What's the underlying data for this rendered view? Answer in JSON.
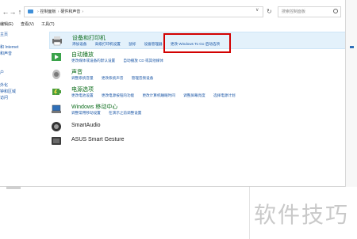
{
  "address_bar": {
    "crumbs": [
      "控制面板",
      "硬件和声音"
    ],
    "search_placeholder": "搜索控制面板"
  },
  "menubar": [
    "编辑(E)",
    "查看(V)",
    "工具(T)"
  ],
  "leftnav": [
    "主页",
    "",
    "和 Internet",
    "和声音",
    "",
    "",
    "户",
    "",
    "外化",
    "钟和区域",
    "访问"
  ],
  "categories": [
    {
      "title": "设备和打印机",
      "links": [
        "添加设备",
        "高级打印机设置",
        "鼠标",
        "设备管理器",
        "更改 Windows To Go 启动选项"
      ],
      "highlight": true,
      "icon": "printer-icon"
    },
    {
      "title": "自动播放",
      "links": [
        "更改媒体或设备的默认设置",
        "自动播放 CD 或其他媒体"
      ],
      "icon": "autoplay-icon"
    },
    {
      "title": "声音",
      "links": [
        "调整系统音量",
        "更改系统声音",
        "管理音频设备"
      ],
      "icon": "speaker-icon"
    },
    {
      "title": "电源选项",
      "links": [
        "更改电池设置",
        "更改电源按钮的功能",
        "更改计算机睡眠时间",
        "调整屏幕亮度",
        "选择电源计划"
      ],
      "icon": "power-icon"
    },
    {
      "title": "Windows 移动中心",
      "links": [
        "调整常用移动设置",
        "在演示之前调整设置"
      ],
      "icon": "mobility-icon"
    },
    {
      "title": "SmartAudio",
      "links": [],
      "icon": "smartaudio-icon"
    },
    {
      "title": "ASUS Smart Gesture",
      "links": [],
      "icon": "touchpad-icon"
    }
  ],
  "watermark": "软件技巧",
  "colors": {
    "link": "#1a56a6",
    "category_title": "#0f6e1e",
    "highlight_bg": "#e3f1fb",
    "annotation_box": "#d20000"
  }
}
